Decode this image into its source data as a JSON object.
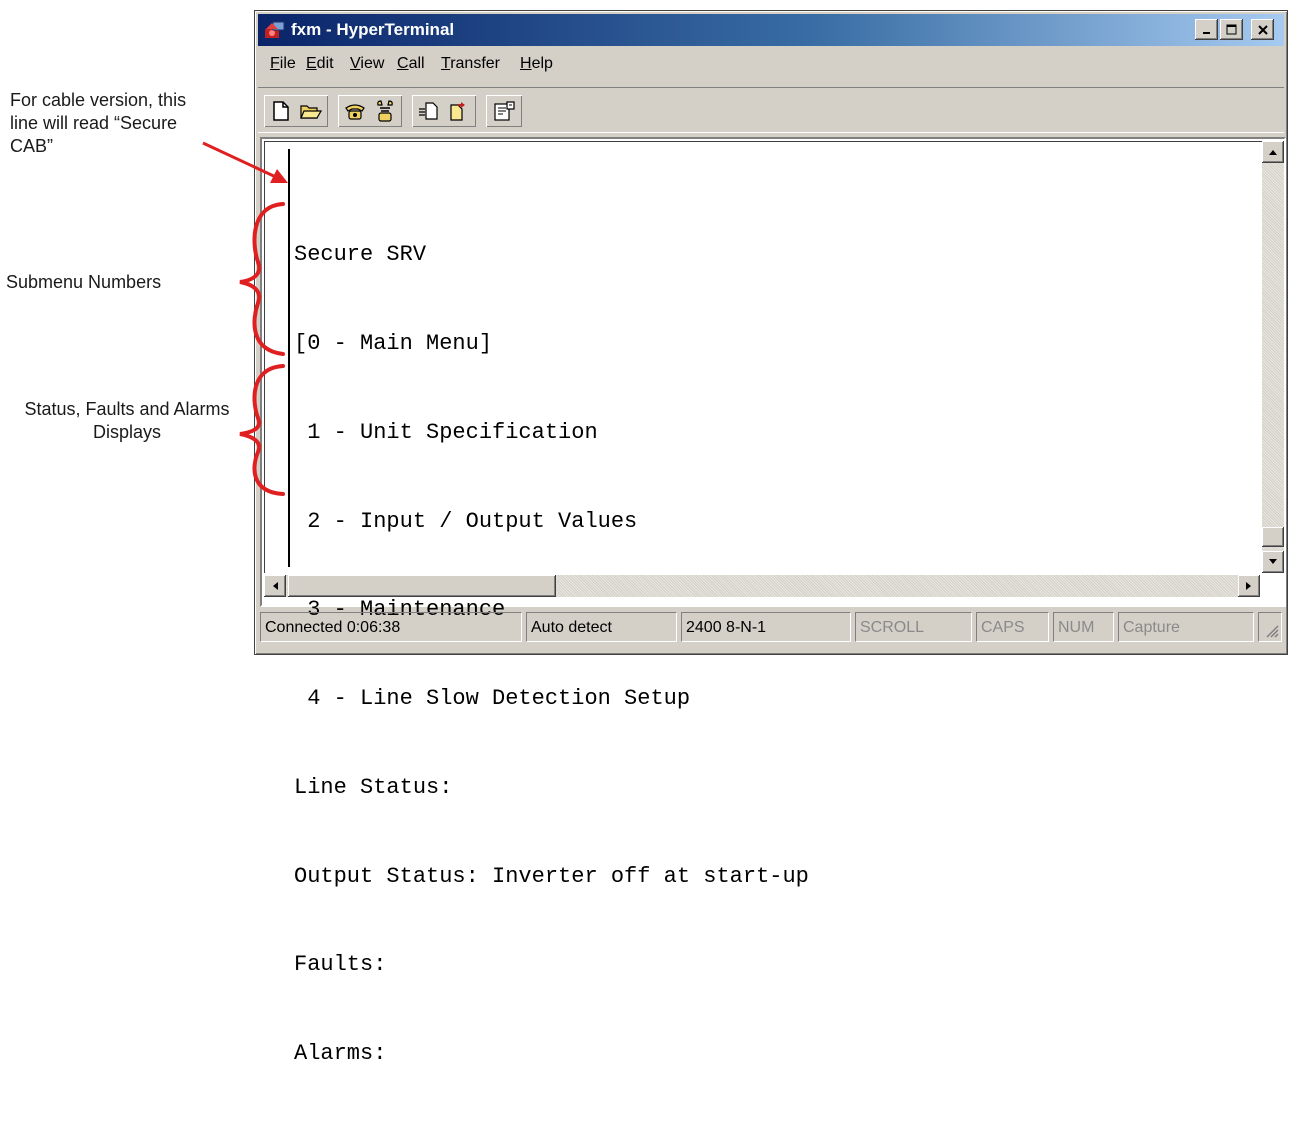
{
  "annotations": {
    "cable_note": "For cable version, this line will read “Secure CAB”",
    "submenu_label": "Submenu Numbers",
    "status_label": "Status, Faults and Alarms Displays"
  },
  "window": {
    "title": "fxm - HyperTerminal"
  },
  "menu": [
    {
      "ul": "F",
      "rest": "ile"
    },
    {
      "ul": "E",
      "rest": "dit"
    },
    {
      "ul": "V",
      "rest": "iew"
    },
    {
      "ul": "C",
      "rest": "all"
    },
    {
      "ul": "T",
      "rest": "ransfer"
    },
    {
      "ul": "H",
      "rest": "elp"
    }
  ],
  "toolbar_icons": [
    "new-document-icon",
    "open-folder-icon",
    "connect-phone-icon",
    "disconnect-phone-icon",
    "send-file-icon",
    "receive-file-icon",
    "properties-icon"
  ],
  "terminal": {
    "lines": [
      "Secure SRV",
      "[0 - Main Menu]",
      " 1 - Unit Specification",
      " 2 - Input / Output Values",
      " 3 - Maintenance",
      " 4 - Line Slow Detection Setup",
      "Line Status:",
      "Output Status: Inverter off at start-up",
      "Faults:",
      "Alarms:"
    ]
  },
  "status": {
    "connection": "Connected 0:06:38",
    "emulation": "Auto detect",
    "port_settings": "2400 8-N-1",
    "scroll": "SCROLL",
    "caps": "CAPS",
    "num": "NUM",
    "capture": "Capture"
  },
  "colors": {
    "annotation_accent": "#e02020",
    "title_bar": "#0a246a",
    "window_face": "#d4d0c8"
  }
}
